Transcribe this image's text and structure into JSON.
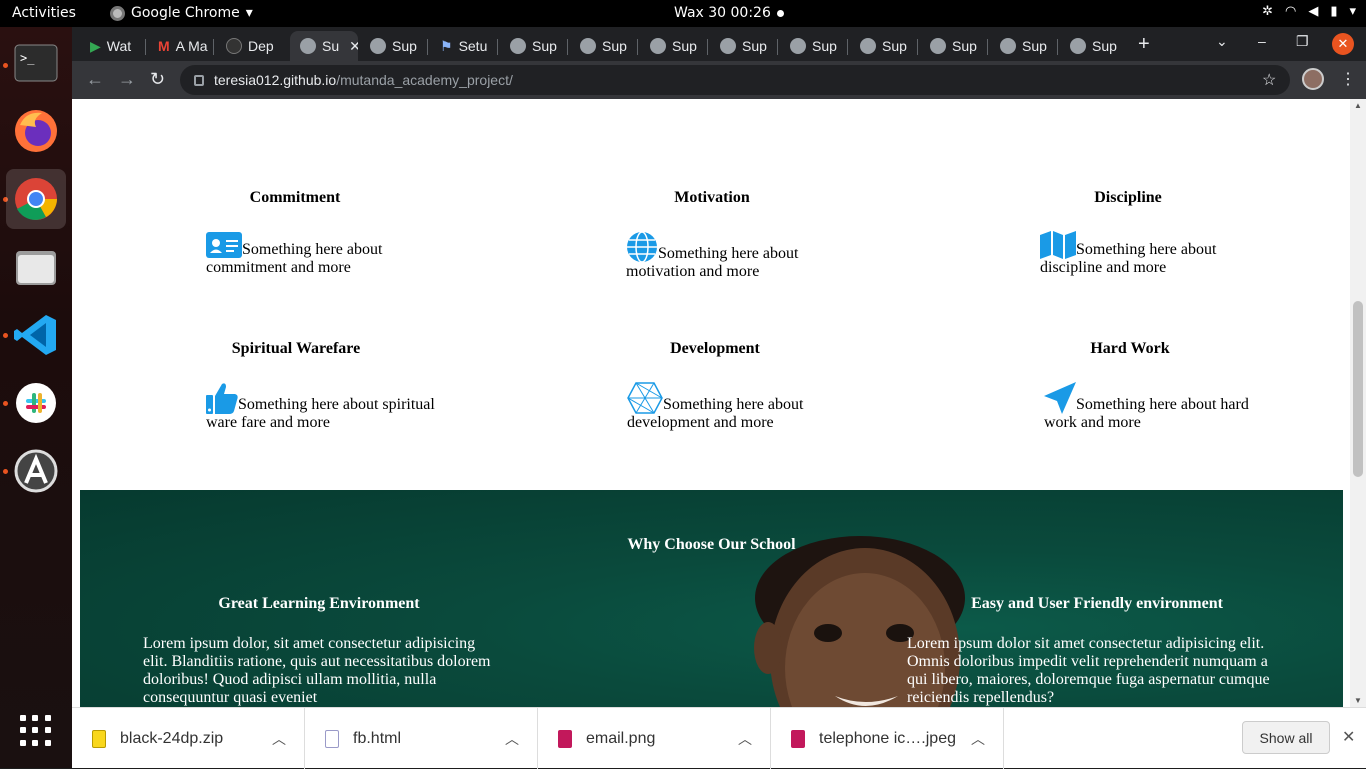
{
  "topbar": {
    "activities": "Activities",
    "app_name": "Google Chrome",
    "clock": "Wax 30  00:26"
  },
  "tabs": [
    {
      "label": "Wat"
    },
    {
      "label": "A Ma"
    },
    {
      "label": "Dep"
    },
    {
      "label": "Su"
    },
    {
      "label": "Sup"
    },
    {
      "label": "Setu"
    },
    {
      "label": "Sup"
    },
    {
      "label": "Sup"
    },
    {
      "label": "Sup"
    },
    {
      "label": "Sup"
    },
    {
      "label": "Sup"
    },
    {
      "label": "Sup"
    },
    {
      "label": "Sup"
    },
    {
      "label": "Sup"
    },
    {
      "label": "Sup"
    }
  ],
  "address": {
    "host": "teresia012.github.io",
    "path": "/mutanda_academy_project/"
  },
  "values": [
    {
      "title": "Commitment",
      "text": "Something here about commitment and more",
      "icon": "id-card-icon"
    },
    {
      "title": "Motivation",
      "text": "Something here about motivation and more",
      "icon": "globe-icon"
    },
    {
      "title": "Discipline",
      "text": "Something here about discipline and more",
      "icon": "map-icon"
    },
    {
      "title": "Spiritual Warefare",
      "text": "Something here about spiritual ware fare and more",
      "icon": "thumbs-up-icon"
    },
    {
      "title": "Development",
      "text": "Something here about development and more",
      "icon": "hexagon-icon"
    },
    {
      "title": "Hard Work",
      "text": "Something here about hard work and more",
      "icon": "paper-plane-icon"
    }
  ],
  "why": {
    "heading": "Why Choose Our School",
    "left_title": "Great Learning Environment",
    "left_text": "Lorem ipsum dolor, sit amet consectetur adipisicing elit. Blanditiis ratione, quis aut necessitatibus dolorem doloribus! Quod adipisci ullam mollitia, nulla consequuntur quasi eveniet",
    "right_title": "Easy and User Friendly environment",
    "right_text": "Lorem ipsum dolor sit amet consectetur adipisicing elit. Omnis doloribus impedit velit reprehenderit numquam a qui libero, maiores, doloremque fuga aspernatur cumque reiciendis repellendus?"
  },
  "downloads": [
    {
      "name": "black-24dp.zip",
      "color": "#f9d71c"
    },
    {
      "name": "fb.html",
      "color": "#b0b0d0"
    },
    {
      "name": "email.png",
      "color": "#c2185b"
    },
    {
      "name": "telephone ic….jpeg",
      "color": "#c2185b"
    }
  ],
  "shelf": {
    "show_all": "Show all"
  },
  "colors": {
    "accent_icon": "#1a9ae6",
    "why_bg": "#0a4a3c",
    "ubuntu_orange": "#e95420"
  }
}
